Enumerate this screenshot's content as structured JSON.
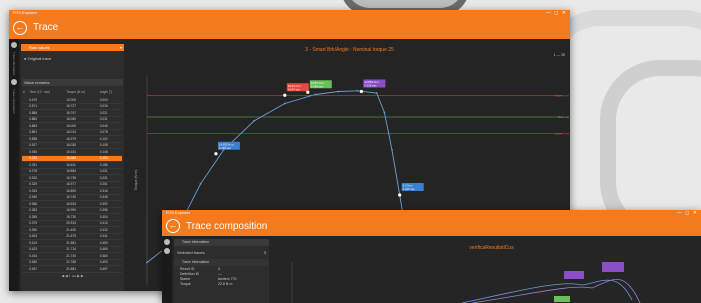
{
  "colors": {
    "accent": "#f47a1e",
    "window_bg": "#252525",
    "panel_bg": "#2d2d2d",
    "curve": "#6a9fd4",
    "limit_red": "#e8493f",
    "limit_green": "#6bbf59"
  },
  "main_window": {
    "app_title": "RTS Explorer",
    "window_controls": "— ◻ ✕",
    "page_title": "Trace",
    "back_icon": "←",
    "trace_dropdown": "Raw values",
    "original_trace_label": "Original trace",
    "values_title": "Value remarks",
    "table_headers": [
      "#",
      "Time (10⁻ sec)",
      "Torque (N·m)",
      "Angle (°)"
    ],
    "table_rows": [
      [
        "",
        "0.479",
        "10.000",
        "0.000"
      ],
      [
        "",
        "0.871",
        "16.727",
        "0.016"
      ],
      [
        "",
        "0.888",
        "16.797",
        "0.021"
      ],
      [
        "",
        "0.883",
        "16.050",
        "0.031"
      ],
      [
        "",
        "0.883",
        "16.000",
        "0.046"
      ],
      [
        "",
        "0.891",
        "16.014",
        "0.078"
      ],
      [
        "",
        "0.898",
        "16.979",
        "0.102"
      ],
      [
        "",
        "0.927",
        "16.030",
        "0.108"
      ],
      [
        "",
        "0.930",
        "16.151",
        "0.148"
      ],
      [
        "",
        "0.233",
        "16.085",
        "0.154"
      ],
      [
        "",
        "0.251",
        "16.611",
        "0.185"
      ],
      [
        "",
        "0.278",
        "16.884",
        "0.221"
      ],
      [
        "",
        "0.320",
        "16.735",
        "0.231"
      ],
      [
        "",
        "0.329",
        "16.977",
        "0.251"
      ],
      [
        "",
        "0.333",
        "16.890",
        "0.316"
      ],
      [
        "",
        "0.349",
        "16.740",
        "0.345"
      ],
      [
        "",
        "0.366",
        "16.633",
        "0.392"
      ],
      [
        "",
        "0.353",
        "16.990",
        "0.396"
      ],
      [
        "",
        "0.355",
        "16.730",
        "0.404"
      ],
      [
        "",
        "0.379",
        "20.913",
        "0.410"
      ],
      [
        "",
        "0.390",
        "21.450",
        "0.432"
      ],
      [
        "",
        "0.403",
        "21.675",
        "0.441"
      ],
      [
        "",
        "0.413",
        "21.681",
        "0.453"
      ],
      [
        "",
        "0.423",
        "21.714",
        "0.469"
      ],
      [
        "",
        "0.434",
        "21.740",
        "0.480"
      ],
      [
        "",
        "0.450",
        "21.765",
        "0.493"
      ],
      [
        "",
        "0.457",
        "21.881",
        "0.497"
      ]
    ],
    "selected_row": 9,
    "pager": "◀ ◀ 1 ◂ ▸ ▶ ▶",
    "chart_icons": "⊞ ⇔ ⊕ ◐ ✕ ◔",
    "chart": {
      "title": "3 - Smart Brk/Angle : Nominal torque 25",
      "ylabel": "Torque (N·m)",
      "xlabel": "",
      "legend": "1 — 25",
      "limit_labels": [
        "Upper limit",
        "Nominal",
        "Lower limit"
      ]
    }
  },
  "chart_data": {
    "type": "line",
    "title": "3 - Smart Brk/Angle : Nominal torque 25",
    "xlabel": "",
    "ylabel": "Torque (N·m)",
    "points": [
      {
        "x": 0.0,
        "y": 0.0
      },
      {
        "x": 0.05,
        "y": 2.0
      },
      {
        "x": 0.1,
        "y": 6.5
      },
      {
        "x": 0.14,
        "y": 10.5
      },
      {
        "x": 0.2,
        "y": 15.0
      },
      {
        "x": 0.28,
        "y": 18.9
      },
      {
        "x": 0.36,
        "y": 21.2
      },
      {
        "x": 0.44,
        "y": 22.4
      },
      {
        "x": 0.5,
        "y": 22.8
      },
      {
        "x": 0.55,
        "y": 22.9
      },
      {
        "x": 0.6,
        "y": 22.6
      },
      {
        "x": 0.62,
        "y": 20.0
      },
      {
        "x": 0.64,
        "y": 15.0
      },
      {
        "x": 0.66,
        "y": 9.0
      },
      {
        "x": 0.68,
        "y": 3.0
      },
      {
        "x": 0.7,
        "y": -3.0
      }
    ],
    "limits": [
      {
        "name": "Upper limit",
        "y": 22.3
      },
      {
        "name": "Nominal",
        "y": 19.4
      },
      {
        "name": "Lower limit",
        "y": 17.2
      }
    ],
    "xlim": [
      0,
      1.05
    ],
    "ylim": [
      -3,
      25
    ],
    "marks": [
      {
        "x": 0.18,
        "y": 14.5,
        "label": "14.555 N·m\n0.103 sec"
      },
      {
        "x": 0.36,
        "y": 22.3,
        "label": "22.31 N·m\n0.147 sec"
      },
      {
        "x": 0.42,
        "y": 22.7,
        "label": "22.84 N·m\n0.148 sec"
      },
      {
        "x": 0.56,
        "y": 22.8,
        "label": "22.853 N·m\n0.215 sec"
      },
      {
        "x": 0.66,
        "y": 9.0,
        "label": "9.3 N·m\n0.245 sec"
      }
    ]
  },
  "comp_window": {
    "app_title": "RTS Explorer",
    "window_controls": "— ◻ ✕",
    "page_title": "Trace composition",
    "trace_info": "Trace information",
    "selected_traces_label": "Selected traces",
    "selected_traces_value": "3",
    "info_title": "Trace information",
    "fields": [
      {
        "k": "Result ID",
        "v": "3"
      },
      {
        "k": "Definition ID",
        "v": "—"
      },
      {
        "k": "Starter",
        "v": "tandem 770"
      },
      {
        "k": "Torque",
        "v": "22.8 N·m"
      }
    ],
    "chart_title": "verificaResultatiCus"
  }
}
